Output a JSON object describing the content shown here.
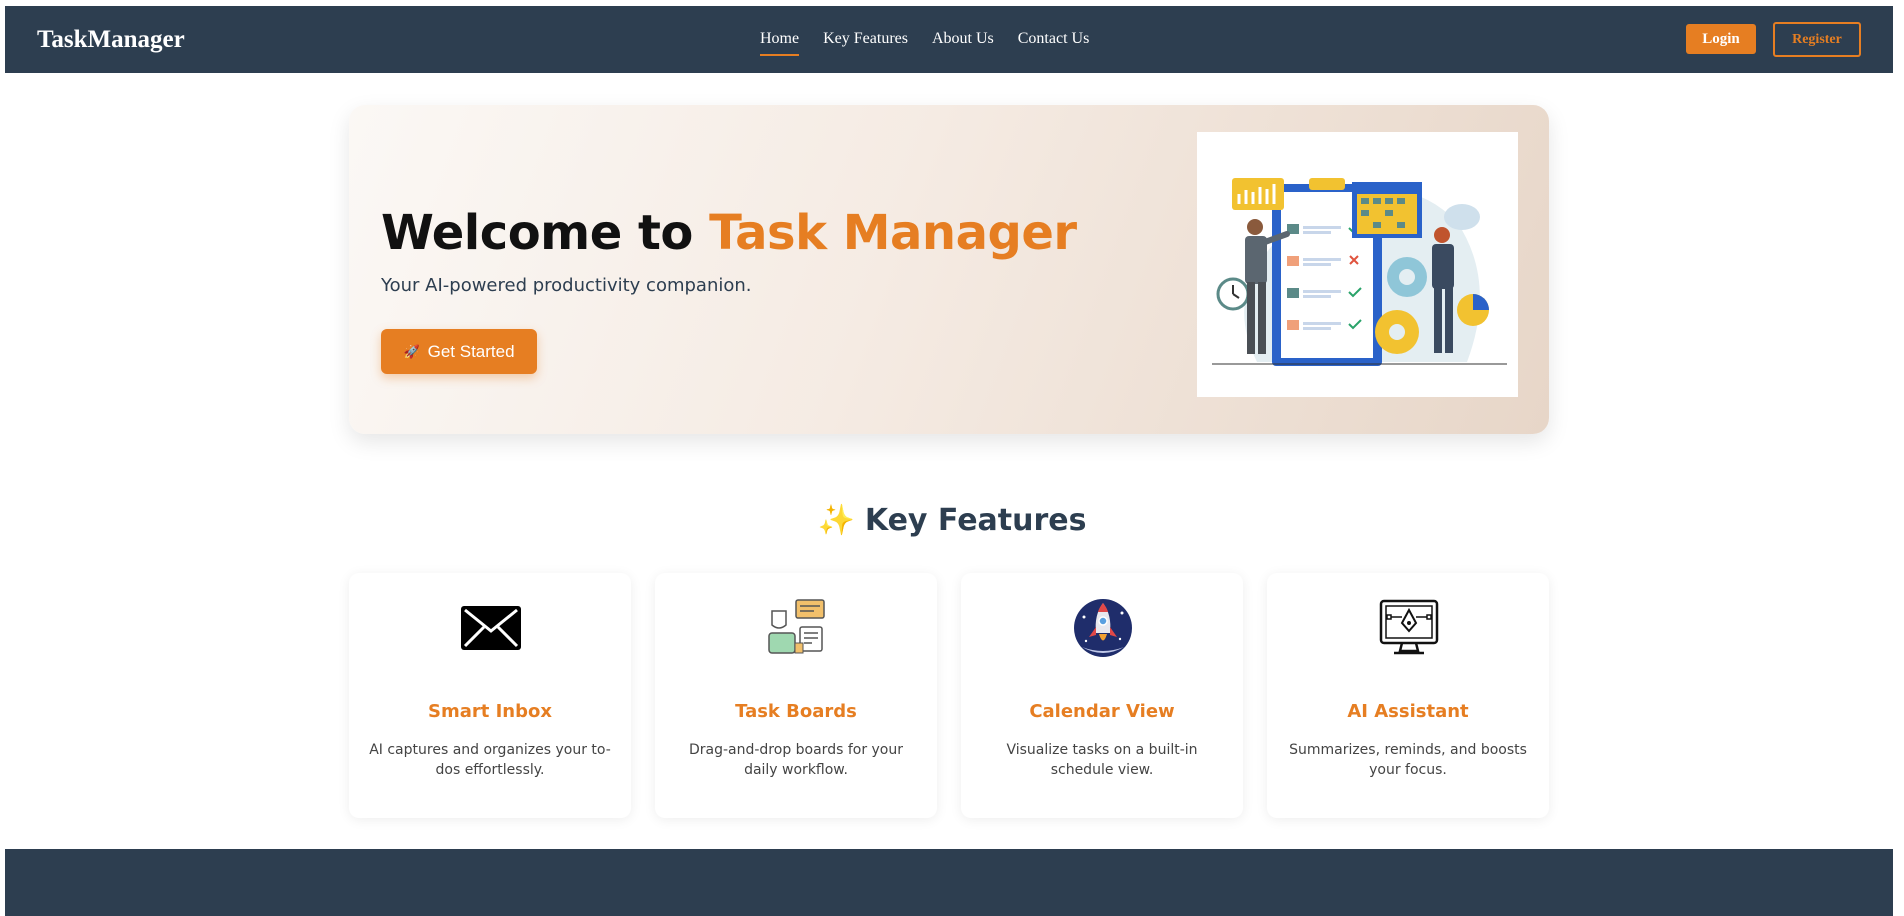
{
  "navbar": {
    "brand": "TaskManager",
    "links": [
      {
        "label": "Home",
        "active": true
      },
      {
        "label": "Key Features",
        "active": false
      },
      {
        "label": "About Us",
        "active": false
      },
      {
        "label": "Contact Us",
        "active": false
      }
    ],
    "login_label": "Login",
    "register_label": "Register"
  },
  "hero": {
    "title_prefix": "Welcome to",
    "title_accent": "Task Manager",
    "subtitle": "Your AI-powered productivity companion.",
    "cta_icon": "🚀",
    "cta_label": "Get Started",
    "illustration": "team-task-board-illustration"
  },
  "features": {
    "heading_icon": "✨",
    "heading": "Key Features",
    "cards": [
      {
        "icon": "envelope-icon",
        "title": "Smart Inbox",
        "desc": "AI captures and organizes your to-dos effortlessly."
      },
      {
        "icon": "board-chat-icon",
        "title": "Task Boards",
        "desc": "Drag-and-drop boards for your daily workflow."
      },
      {
        "icon": "rocket-icon",
        "title": "Calendar View",
        "desc": "Visualize tasks on a built-in schedule view."
      },
      {
        "icon": "monitor-design-icon",
        "title": "AI Assistant",
        "desc": "Summarizes, reminds, and boosts your focus."
      }
    ]
  },
  "colors": {
    "nav_bg": "#2d3e50",
    "accent": "#e67e22",
    "footer_bg": "#2d3e50"
  }
}
